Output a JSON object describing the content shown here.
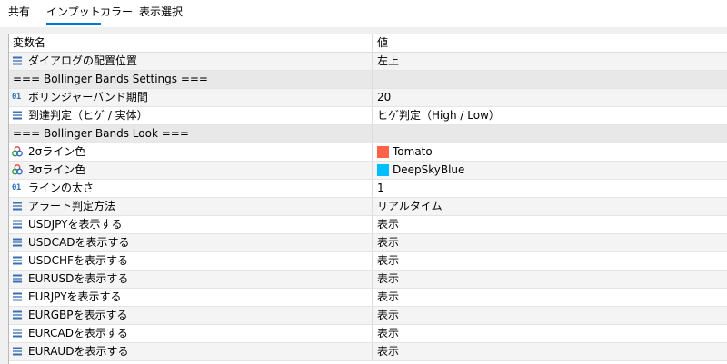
{
  "tabs": [
    {
      "label": "共有"
    },
    {
      "label": "インプット",
      "active": true
    },
    {
      "label": "カラー"
    },
    {
      "label": "表示選択"
    }
  ],
  "table": {
    "headers": {
      "name": "変数名",
      "value": "値"
    },
    "rows": [
      {
        "name": "ダイアログの配置位置",
        "value": "左上",
        "icon": "enum-icon"
      },
      {
        "name": "=== Bollinger Bands Settings ===",
        "value": "",
        "icon": "none",
        "group": true
      },
      {
        "name": "ボリンジャーバンド期間",
        "value": "20",
        "icon": "int-icon",
        "icon_text": "01"
      },
      {
        "name": "到達判定（ヒゲ / 実体）",
        "value": "ヒゲ判定（High / Low）",
        "icon": "enum-icon"
      },
      {
        "name": "=== Bollinger Bands Look ===",
        "value": "",
        "icon": "none",
        "group": true
      },
      {
        "name": "2σライン色",
        "value": "Tomato",
        "icon": "color-icon",
        "swatch": "#ff6347"
      },
      {
        "name": "3σライン色",
        "value": "DeepSkyBlue",
        "icon": "color-icon",
        "swatch": "#00bfff"
      },
      {
        "name": "ラインの太さ",
        "value": "1",
        "icon": "int-icon",
        "icon_text": "01"
      },
      {
        "name": "アラート判定方法",
        "value": "リアルタイム",
        "icon": "enum-icon"
      },
      {
        "name": "USDJPYを表示する",
        "value": "表示",
        "icon": "enum-icon"
      },
      {
        "name": "USDCADを表示する",
        "value": "表示",
        "icon": "enum-icon"
      },
      {
        "name": "USDCHFを表示する",
        "value": "表示",
        "icon": "enum-icon"
      },
      {
        "name": "EURUSDを表示する",
        "value": "表示",
        "icon": "enum-icon"
      },
      {
        "name": "EURJPYを表示する",
        "value": "表示",
        "icon": "enum-icon"
      },
      {
        "name": "EURGBPを表示する",
        "value": "表示",
        "icon": "enum-icon"
      },
      {
        "name": "EURCADを表示する",
        "value": "表示",
        "icon": "enum-icon"
      },
      {
        "name": "EURAUDを表示する",
        "value": "表示",
        "icon": "enum-icon"
      }
    ]
  },
  "colors": {
    "accent": "#0078d7",
    "enum_icon": "#3a6fb0",
    "int_icon": "#2a6fc1"
  }
}
